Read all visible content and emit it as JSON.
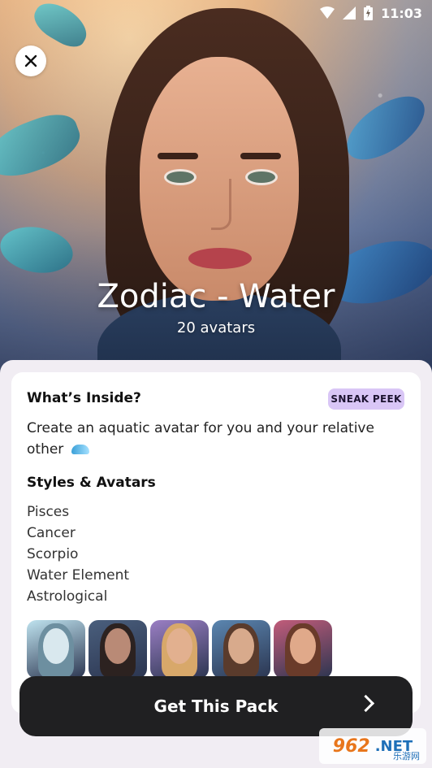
{
  "status_bar": {
    "time": "11:03"
  },
  "hero": {
    "title": "Zodiac - Water",
    "subtitle": "20 avatars"
  },
  "card": {
    "title": "What’s Inside?",
    "badge": "SNEAK PEEK",
    "description": "Create an aquatic avatar for you and your relative other",
    "styles_title": "Styles & Avatars",
    "styles": [
      "Pisces",
      "Cancer",
      "Scorpio",
      "Water Element",
      "Astrological"
    ]
  },
  "thumbnails": [
    {
      "name": "avatar-1",
      "bg": "#bfe3ef",
      "skin": "#d9e8ee",
      "hair": "#6d8fa0"
    },
    {
      "name": "avatar-2",
      "bg": "#4a5f7d",
      "skin": "#b98a76",
      "hair": "#2c2220"
    },
    {
      "name": "avatar-3",
      "bg": "#9b7fc4",
      "skin": "#e2b08f",
      "hair": "#d8a86a"
    },
    {
      "name": "avatar-4",
      "bg": "#5b86b0",
      "skin": "#d8aa8c",
      "hair": "#5a3b2c"
    },
    {
      "name": "avatar-5",
      "bg": "#c15c7a",
      "skin": "#e0a98a",
      "hair": "#6a3b2a"
    }
  ],
  "cta": {
    "label": "Get This Pack"
  },
  "watermark": {
    "number": "962",
    "suffix": ".NET",
    "chinese": "乐游网"
  }
}
